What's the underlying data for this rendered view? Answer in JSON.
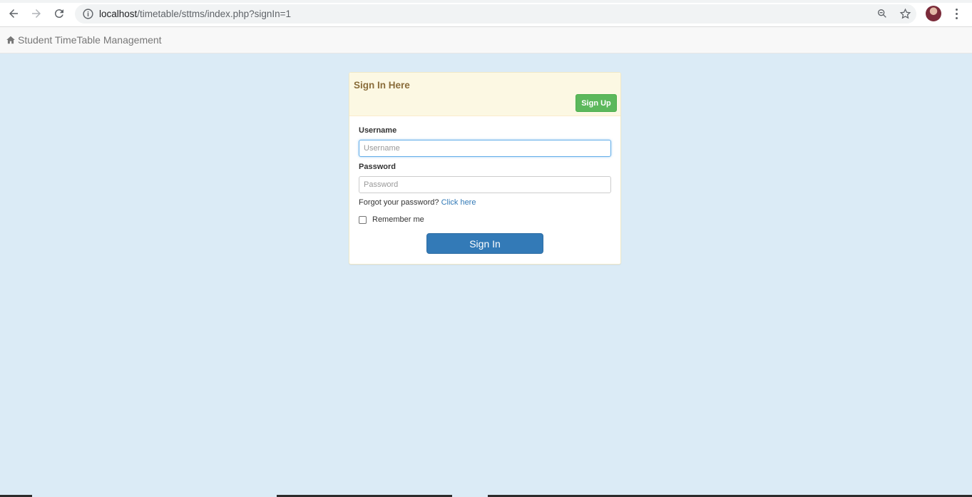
{
  "browser": {
    "url_host": "localhost",
    "url_path": "/timetable/sttms/index.php?signIn=1",
    "icons": {
      "back": "back-arrow-icon",
      "forward": "forward-arrow-icon",
      "reload": "reload-icon",
      "info": "info-icon",
      "zoom": "zoom-icon",
      "bookmark": "star-icon",
      "menu": "kebab-menu-icon"
    }
  },
  "navbar": {
    "brand_label": "Student TimeTable Management",
    "brand_icon": "home-icon"
  },
  "signin_panel": {
    "title": "Sign In Here",
    "signup_label": "Sign Up",
    "username_label": "Username",
    "username_placeholder": "Username",
    "username_value": "",
    "password_label": "Password",
    "password_placeholder": "Password",
    "password_value": "",
    "forgot_text": "Forgot your password?",
    "forgot_link": "Click here",
    "remember_label": "Remember me",
    "remember_checked": false,
    "signin_label": "Sign In"
  },
  "colors": {
    "page_background": "#dbebf6",
    "panel_heading": "#fcf8e3",
    "title_text": "#8a6d3b",
    "signup_button": "#5cb85c",
    "signin_button": "#337ab7",
    "link": "#337ab7"
  }
}
